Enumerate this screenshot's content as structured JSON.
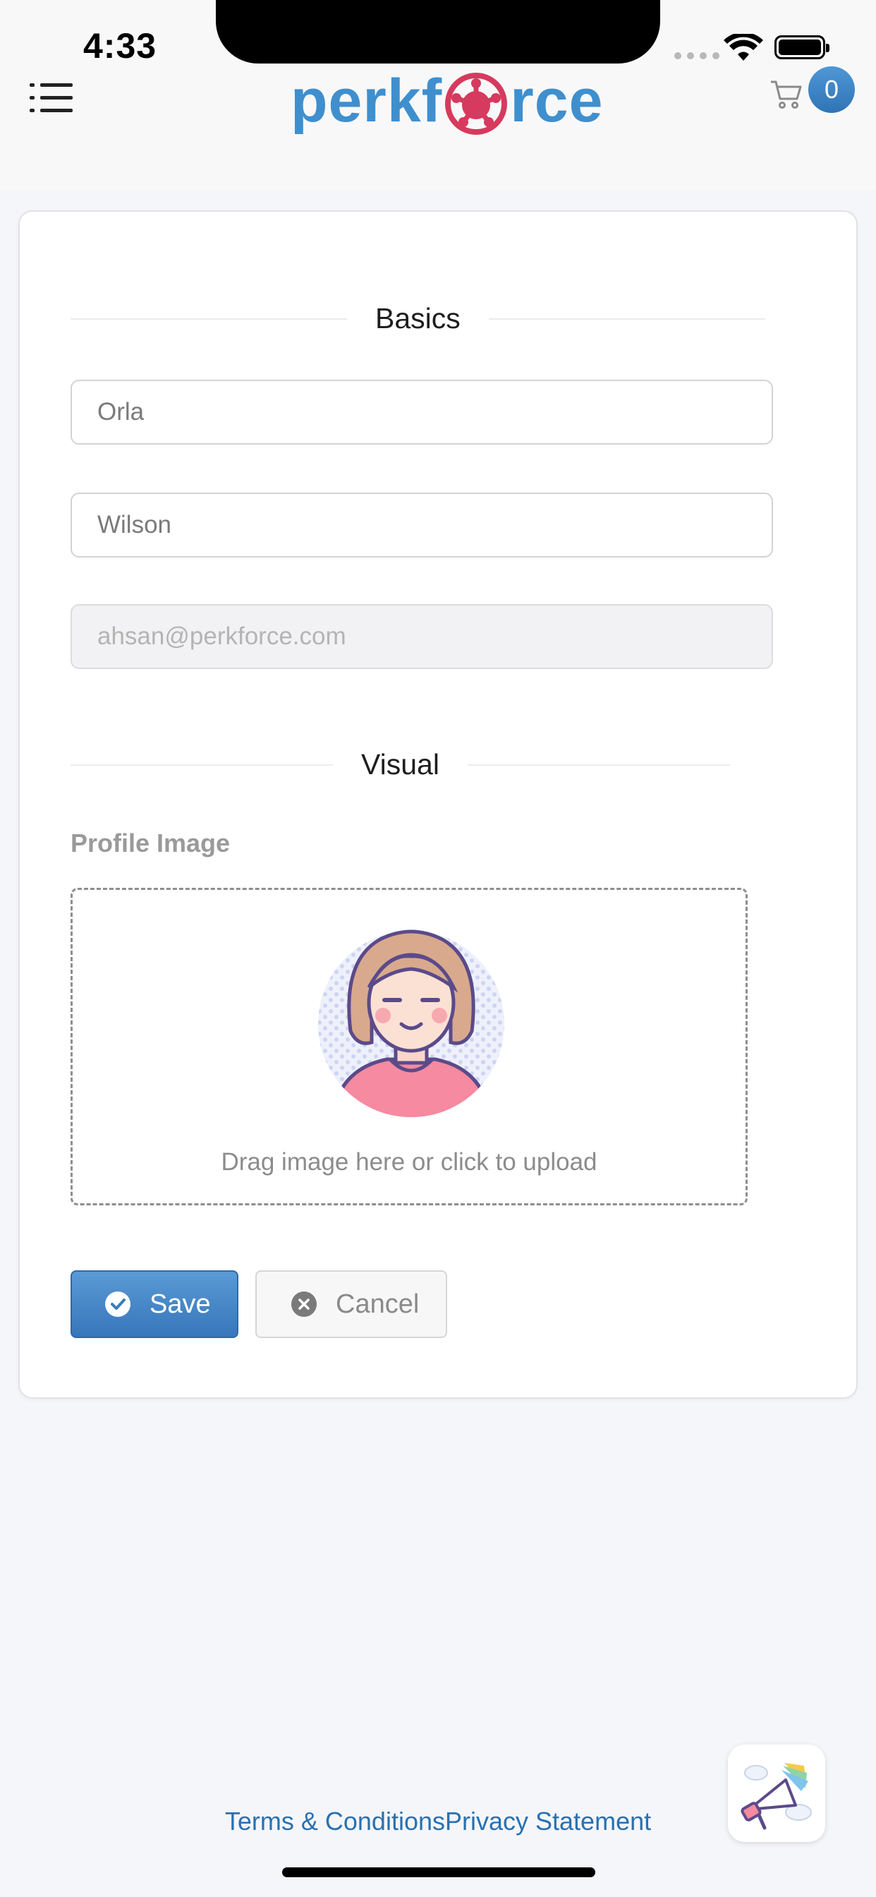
{
  "status_bar": {
    "time": "4:33"
  },
  "header": {
    "logo_left": "perkf",
    "logo_right": "rce",
    "cart_count": "0"
  },
  "form": {
    "basics_title": "Basics",
    "first_name_value": "Orla",
    "last_name_value": "Wilson",
    "email_value": "ahsan@perkforce.com",
    "visual_title": "Visual",
    "profile_image_label": "Profile Image",
    "dropzone_text": "Drag image here or click to upload",
    "save_label": "Save",
    "cancel_label": "Cancel"
  },
  "footer": {
    "terms_label": "Terms & Conditions",
    "privacy_label": "Privacy Statement"
  },
  "colors": {
    "accent": "#3f8fce",
    "logo_mark": "#d63a5e",
    "save_button": "#3776b9",
    "link": "#2a70b0"
  }
}
